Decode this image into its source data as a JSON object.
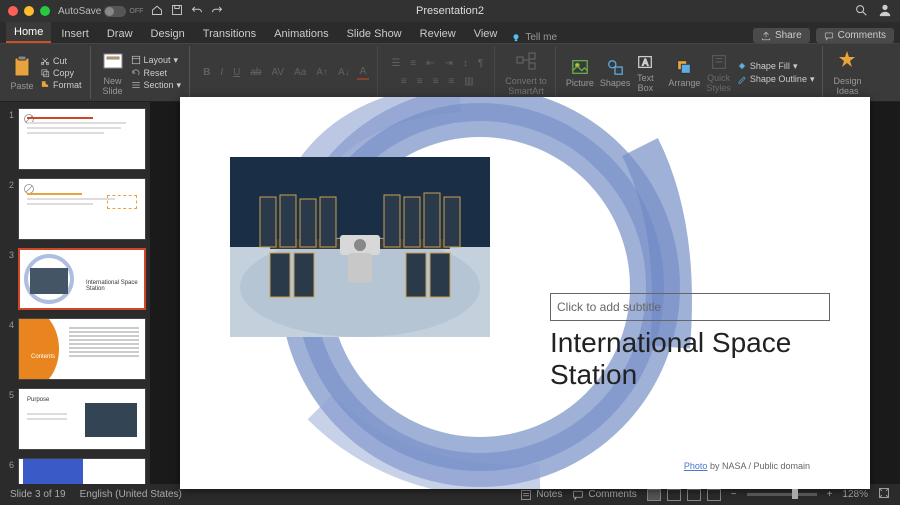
{
  "titlebar": {
    "autosave_label": "AutoSave",
    "autosave_state": "OFF",
    "doc_title": "Presentation2"
  },
  "tabs": {
    "items": [
      "Home",
      "Insert",
      "Draw",
      "Design",
      "Transitions",
      "Animations",
      "Slide Show",
      "Review",
      "View"
    ],
    "active": 0,
    "tell_me": "Tell me",
    "share": "Share",
    "comments": "Comments"
  },
  "ribbon": {
    "paste": "Paste",
    "cut": "Cut",
    "copy": "Copy",
    "format": "Format",
    "new_slide": "New\nSlide",
    "layout": "Layout",
    "reset": "Reset",
    "section": "Section",
    "convert": "Convert to\nSmartArt",
    "picture": "Picture",
    "shapes": "Shapes",
    "textbox": "Text\nBox",
    "arrange": "Arrange",
    "quick_styles": "Quick\nStyles",
    "shape_fill": "Shape Fill",
    "shape_outline": "Shape Outline",
    "design_ideas": "Design\nIdeas"
  },
  "thumbs": {
    "count": 6
  },
  "slide": {
    "subtitle_placeholder": "Click to add subtitle",
    "title": "International Space Station",
    "credit_link": "Photo",
    "credit_rest": " by NASA / Public domain",
    "thumb_title": "International Space\nStation",
    "thumb4_label": "Contents",
    "thumb5_title": "Purpose"
  },
  "status": {
    "slide_pos": "Slide 3 of 19",
    "lang": "English (United States)",
    "notes": "Notes",
    "comments": "Comments",
    "zoom": "128%"
  }
}
